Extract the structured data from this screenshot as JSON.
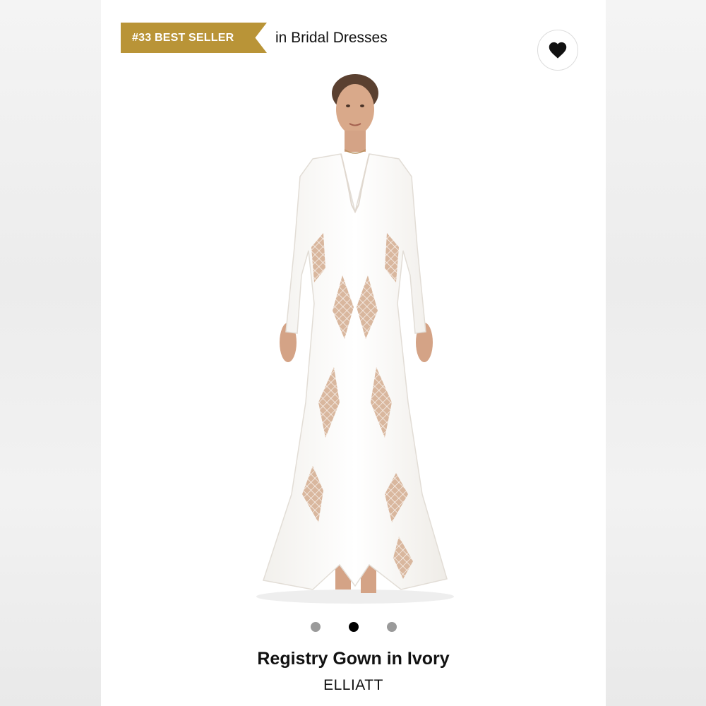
{
  "badge": {
    "rank_label": "#33 BEST SELLER",
    "category_text": "in Bridal Dresses",
    "color": "#b99437"
  },
  "favorite": {
    "icon": "heart-icon",
    "active": true
  },
  "product": {
    "image_icon": "white-lace-gown-photo",
    "title": "Registry Gown in Ivory",
    "brand": "ELLIATT"
  },
  "carousel": {
    "count": 3,
    "active_index": 1
  }
}
